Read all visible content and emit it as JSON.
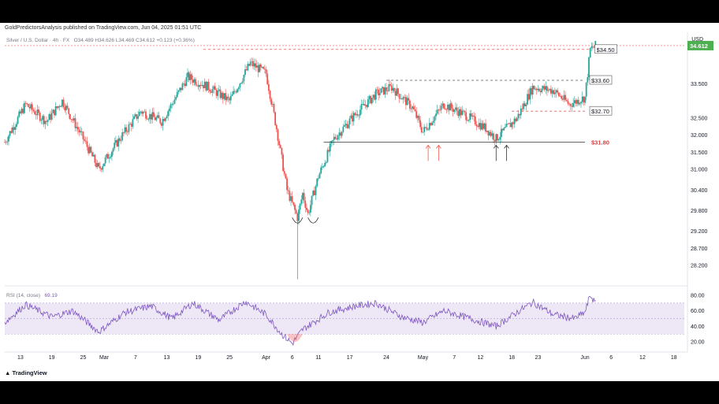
{
  "header": {
    "publisher": "GoldPredictorsAnalysis published on TradingView.com, Jun 04, 2025 01:51 UTC"
  },
  "legend": {
    "symbol": "Silver / U.S. Dollar · 4h · FX",
    "ohlc": "O34.489 H34.626 L34.469 C34.612 +0.123 (+0.36%)"
  },
  "currency": "USD",
  "brand": "TradingView",
  "colors": {
    "up": "#26a69a",
    "down": "#ef5350",
    "rsi_line": "#7e57c2",
    "rsi_band": "#ede7f6",
    "last_price_bg": "#4caf50",
    "support_label": "#e53935"
  },
  "chart_data": {
    "type": "candlestick",
    "title": "",
    "y_axis": {
      "ticks": [
        34.612,
        33.5,
        32.5,
        32.0,
        31.5,
        31.0,
        30.4,
        29.8,
        29.2,
        28.7,
        28.2
      ],
      "tick_labels": [
        "34.612",
        "33.500",
        "32.500",
        "32.000",
        "31.500",
        "31.000",
        "30.400",
        "29.800",
        "29.200",
        "28.700",
        "28.200"
      ],
      "range": [
        27.7,
        35.0
      ]
    },
    "x_axis": {
      "tick_labels": [
        "13",
        "19",
        "25",
        "Mar",
        "7",
        "13",
        "19",
        "25",
        "Apr",
        "6",
        "11",
        "17",
        "24",
        "May",
        "7",
        "12",
        "18",
        "23",
        "Jun",
        "6",
        "12",
        "18"
      ],
      "tick_dates": [
        "2025-02-13",
        "2025-02-19",
        "2025-02-25",
        "2025-03-01",
        "2025-03-07",
        "2025-03-13",
        "2025-03-19",
        "2025-03-25",
        "2025-04-01",
        "2025-04-06",
        "2025-04-11",
        "2025-04-17",
        "2025-04-24",
        "2025-05-01",
        "2025-05-07",
        "2025-05-12",
        "2025-05-18",
        "2025-05-23",
        "2025-06-01",
        "2025-06-06",
        "2025-06-12",
        "2025-06-18"
      ]
    },
    "price_path": [
      {
        "date": "2025-02-10",
        "price": 31.8
      },
      {
        "date": "2025-02-14",
        "price": 32.9
      },
      {
        "date": "2025-02-18",
        "price": 32.4
      },
      {
        "date": "2025-02-21",
        "price": 33.0
      },
      {
        "date": "2025-02-25",
        "price": 31.9
      },
      {
        "date": "2025-02-28",
        "price": 31.0
      },
      {
        "date": "2025-03-04",
        "price": 31.9
      },
      {
        "date": "2025-03-08",
        "price": 32.7
      },
      {
        "date": "2025-03-12",
        "price": 32.4
      },
      {
        "date": "2025-03-17",
        "price": 33.7
      },
      {
        "date": "2025-03-21",
        "price": 33.4
      },
      {
        "date": "2025-03-25",
        "price": 33.0
      },
      {
        "date": "2025-03-29",
        "price": 34.1
      },
      {
        "date": "2025-04-01",
        "price": 33.8
      },
      {
        "date": "2025-04-03",
        "price": 32.2
      },
      {
        "date": "2025-04-05",
        "price": 30.4
      },
      {
        "date": "2025-04-07",
        "price": 29.6
      },
      {
        "date": "2025-04-08",
        "price": 30.3
      },
      {
        "date": "2025-04-09",
        "price": 29.7
      },
      {
        "date": "2025-04-11",
        "price": 30.8
      },
      {
        "date": "2025-04-14",
        "price": 31.9
      },
      {
        "date": "2025-04-18",
        "price": 32.6
      },
      {
        "date": "2025-04-22",
        "price": 33.2
      },
      {
        "date": "2025-04-25",
        "price": 33.4
      },
      {
        "date": "2025-04-29",
        "price": 32.8
      },
      {
        "date": "2025-05-01",
        "price": 32.1
      },
      {
        "date": "2025-05-05",
        "price": 32.9
      },
      {
        "date": "2025-05-09",
        "price": 32.6
      },
      {
        "date": "2025-05-13",
        "price": 32.2
      },
      {
        "date": "2025-05-15",
        "price": 31.9
      },
      {
        "date": "2025-05-19",
        "price": 32.5
      },
      {
        "date": "2025-05-22",
        "price": 33.4
      },
      {
        "date": "2025-05-26",
        "price": 33.3
      },
      {
        "date": "2025-05-29",
        "price": 32.9
      },
      {
        "date": "2025-06-01",
        "price": 33.1
      },
      {
        "date": "2025-06-02",
        "price": 34.5
      },
      {
        "date": "2025-06-03",
        "price": 34.61
      }
    ],
    "last_price": 34.612,
    "levels": [
      {
        "value": 34.5,
        "label": "$34.50"
      },
      {
        "value": 33.6,
        "label": "$33.60"
      },
      {
        "value": 32.7,
        "label": "$32.70"
      },
      {
        "value": 31.8,
        "label": "$31.80"
      }
    ],
    "rsi": {
      "label": "RSI (14, close)",
      "value": "69.19",
      "ticks": [
        "80.00",
        "60.00",
        "40.00",
        "20.00"
      ],
      "range": [
        10,
        88
      ],
      "band": [
        30,
        70
      ],
      "path": [
        {
          "date": "2025-02-10",
          "value": 45
        },
        {
          "date": "2025-02-14",
          "value": 68
        },
        {
          "date": "2025-02-19",
          "value": 52
        },
        {
          "date": "2025-02-23",
          "value": 60
        },
        {
          "date": "2025-02-28",
          "value": 33
        },
        {
          "date": "2025-03-05",
          "value": 58
        },
        {
          "date": "2025-03-10",
          "value": 66
        },
        {
          "date": "2025-03-14",
          "value": 50
        },
        {
          "date": "2025-03-18",
          "value": 70
        },
        {
          "date": "2025-03-23",
          "value": 48
        },
        {
          "date": "2025-03-28",
          "value": 72
        },
        {
          "date": "2025-04-01",
          "value": 55
        },
        {
          "date": "2025-04-04",
          "value": 30
        },
        {
          "date": "2025-04-06",
          "value": 18
        },
        {
          "date": "2025-04-08",
          "value": 36
        },
        {
          "date": "2025-04-13",
          "value": 58
        },
        {
          "date": "2025-04-18",
          "value": 66
        },
        {
          "date": "2025-04-22",
          "value": 70
        },
        {
          "date": "2025-04-27",
          "value": 52
        },
        {
          "date": "2025-05-01",
          "value": 45
        },
        {
          "date": "2025-05-05",
          "value": 60
        },
        {
          "date": "2025-05-10",
          "value": 50
        },
        {
          "date": "2025-05-15",
          "value": 40
        },
        {
          "date": "2025-05-19",
          "value": 58
        },
        {
          "date": "2025-05-22",
          "value": 71
        },
        {
          "date": "2025-05-26",
          "value": 55
        },
        {
          "date": "2025-05-30",
          "value": 50
        },
        {
          "date": "2025-06-01",
          "value": 58
        },
        {
          "date": "2025-06-02",
          "value": 80
        },
        {
          "date": "2025-06-03",
          "value": 69.19
        }
      ]
    }
  }
}
